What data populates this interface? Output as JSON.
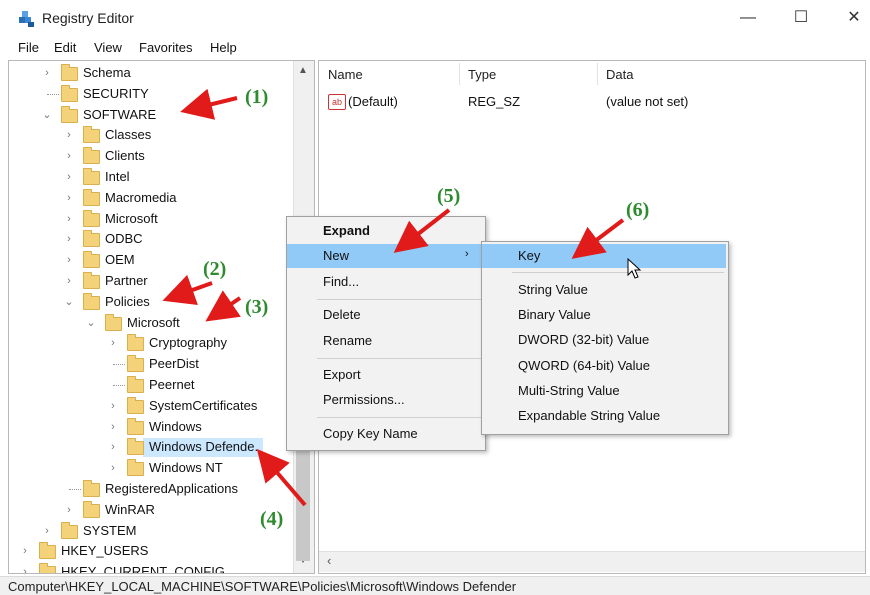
{
  "window": {
    "title": "Registry Editor",
    "minimize": "—",
    "maximize": "☐",
    "close": "✕"
  },
  "menu": [
    "File",
    "Edit",
    "View",
    "Favorites",
    "Help"
  ],
  "tree": [
    {
      "label": "Schema",
      "indent": 2
    },
    {
      "label": "SECURITY",
      "indent": 2
    },
    {
      "label": "SOFTWARE",
      "indent": 2
    },
    {
      "label": "Classes",
      "indent": 3
    },
    {
      "label": "Clients",
      "indent": 3
    },
    {
      "label": "Intel",
      "indent": 3
    },
    {
      "label": "Macromedia",
      "indent": 3
    },
    {
      "label": "Microsoft",
      "indent": 3
    },
    {
      "label": "ODBC",
      "indent": 3
    },
    {
      "label": "OEM",
      "indent": 3
    },
    {
      "label": "Partner",
      "indent": 3
    },
    {
      "label": "Policies",
      "indent": 3
    },
    {
      "label": "Microsoft",
      "indent": 4
    },
    {
      "label": "Cryptography",
      "indent": 5
    },
    {
      "label": "PeerDist",
      "indent": 5
    },
    {
      "label": "Peernet",
      "indent": 5
    },
    {
      "label": "SystemCertificates",
      "indent": 5
    },
    {
      "label": "Windows",
      "indent": 5
    },
    {
      "label": "Windows Defende.",
      "indent": 5
    },
    {
      "label": "Windows NT",
      "indent": 5
    },
    {
      "label": "RegisteredApplications",
      "indent": 3
    },
    {
      "label": "WinRAR",
      "indent": 3
    },
    {
      "label": "SYSTEM",
      "indent": 2
    },
    {
      "label": "HKEY_USERS",
      "indent": 1
    },
    {
      "label": "HKEY_CURRENT_CONFIG",
      "indent": 1
    }
  ],
  "values_table": {
    "headers": [
      "Name",
      "Type",
      "Data"
    ],
    "rows": [
      {
        "name": "(Default)",
        "type": "REG_SZ",
        "data": "(value not set)",
        "icon": "string-value-icon"
      }
    ]
  },
  "context_menu": {
    "items": [
      "Expand",
      "New",
      "Find...",
      "Delete",
      "Rename",
      "Export",
      "Permissions...",
      "Copy Key Name"
    ],
    "highlighted": "New"
  },
  "submenu": {
    "items": [
      "Key",
      "String Value",
      "Binary Value",
      "DWORD (32-bit) Value",
      "QWORD (64-bit) Value",
      "Multi-String Value",
      "Expandable String Value"
    ],
    "highlighted": "Key"
  },
  "status": "Computer\\HKEY_LOCAL_MACHINE\\SOFTWARE\\Policies\\Microsoft\\Windows Defender",
  "annotations": [
    "(1)",
    "(2)",
    "(3)",
    "(4)",
    "(5)",
    "(6)"
  ],
  "colors": {
    "annotation_arrow": "#e11a1a",
    "annotation_text": "#2e8b2e",
    "menu_highlight": "#91c9f7",
    "folder": "#f3d27a"
  }
}
